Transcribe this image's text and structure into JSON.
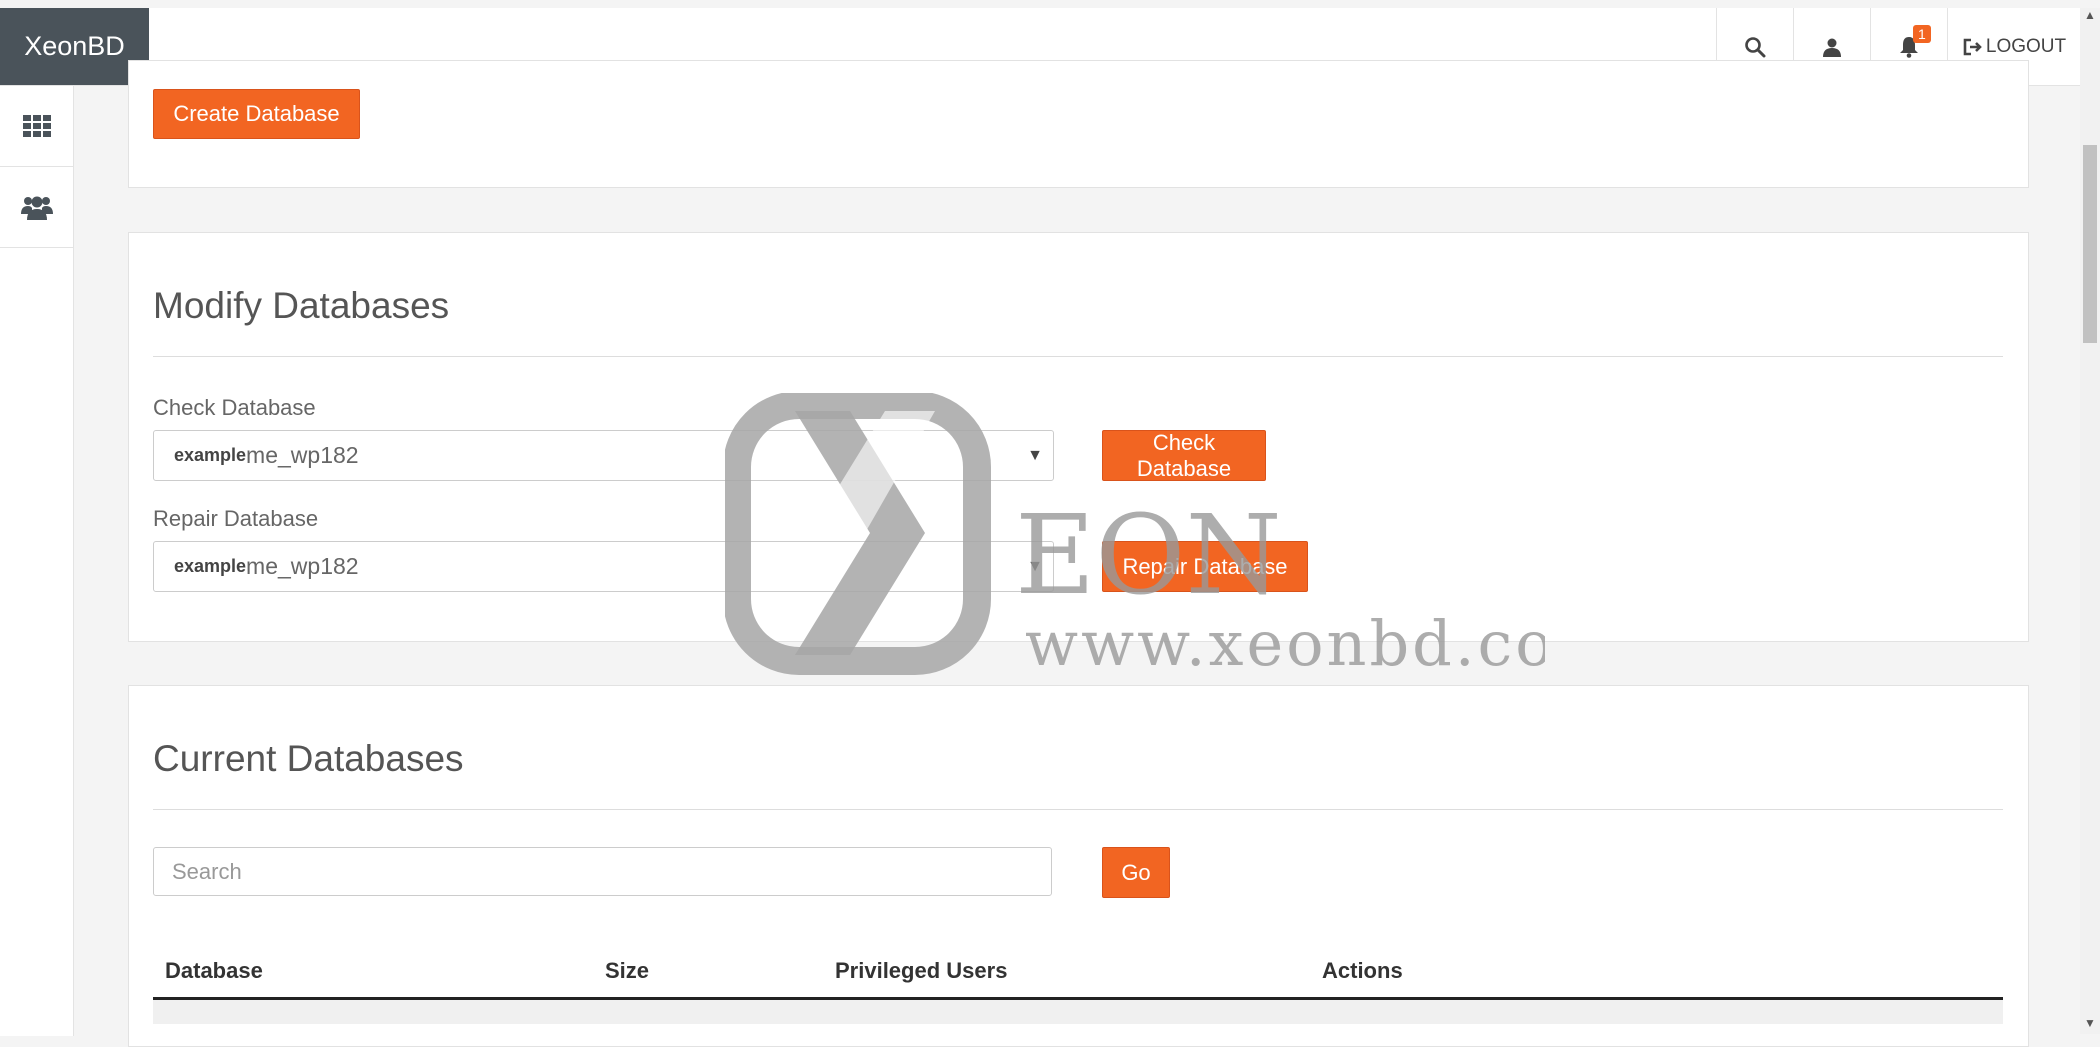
{
  "brand": "XeonBD",
  "topbar": {
    "notification_count": "1",
    "logout_label": "LOGOUT"
  },
  "sidebar": {
    "items": [
      {
        "icon": "grid-icon"
      },
      {
        "icon": "users-icon"
      }
    ]
  },
  "create": {
    "button_label": "Create Database"
  },
  "modify": {
    "title": "Modify Databases",
    "check_label": "Check Database",
    "check_prefix": "example",
    "check_value": "me_wp182",
    "check_button": "Check Database",
    "repair_label": "Repair Database",
    "repair_prefix": "example",
    "repair_value": "me_wp182",
    "repair_button": "Repair Database"
  },
  "current": {
    "title": "Current Databases",
    "search_placeholder": "Search",
    "go_button": "Go",
    "columns": [
      "Database",
      "Size",
      "Privileged Users",
      "Actions"
    ]
  },
  "watermark": {
    "word": "EON",
    "url": "www.xeonbd.com"
  },
  "colors": {
    "accent": "#f26522",
    "brand_bg": "#4a535a"
  }
}
